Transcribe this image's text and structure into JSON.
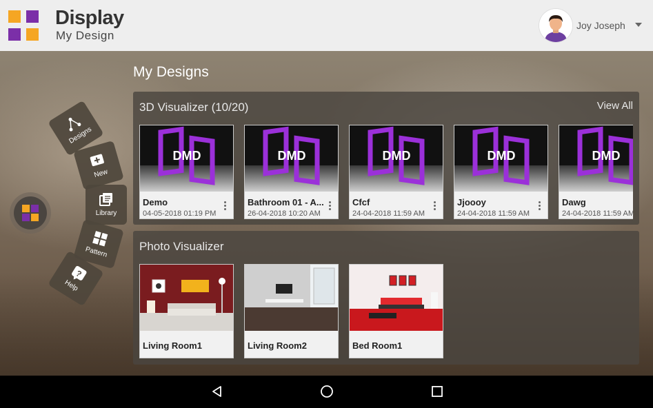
{
  "brand": {
    "title": "Display",
    "subtitle": "My Design"
  },
  "user": {
    "name": "Joy Joseph"
  },
  "page": {
    "title": "My Designs"
  },
  "visualizer_3d": {
    "title": "3D Visualizer (10/20)",
    "view_all": "View All",
    "thumb_text": "DMD",
    "items": [
      {
        "name": "Demo",
        "date": "04-05-2018 01:19 PM"
      },
      {
        "name": "Bathroom 01 - A...",
        "date": "26-04-2018 10:20 AM"
      },
      {
        "name": "Cfcf",
        "date": "24-04-2018 11:59 AM"
      },
      {
        "name": "Jjoooy",
        "date": "24-04-2018 11:59 AM"
      },
      {
        "name": "Dawg",
        "date": "24-04-2018 11:59 AM"
      }
    ]
  },
  "photo_visualizer": {
    "title": "Photo Visualizer",
    "items": [
      {
        "name": "Living Room1"
      },
      {
        "name": "Living Room2"
      },
      {
        "name": "Bed Room1"
      }
    ]
  },
  "arc_menu": [
    {
      "label": "Designs",
      "icon": "nodes-icon"
    },
    {
      "label": "New",
      "icon": "add-icon"
    },
    {
      "label": "Library",
      "icon": "library-icon"
    },
    {
      "label": "Pattern",
      "icon": "pattern-icon"
    },
    {
      "label": "Help",
      "icon": "help-icon"
    }
  ],
  "colors": {
    "logo_orange": "#f5a623",
    "logo_purple": "#7b2fa8",
    "dmd_purple": "#9b30d9"
  }
}
